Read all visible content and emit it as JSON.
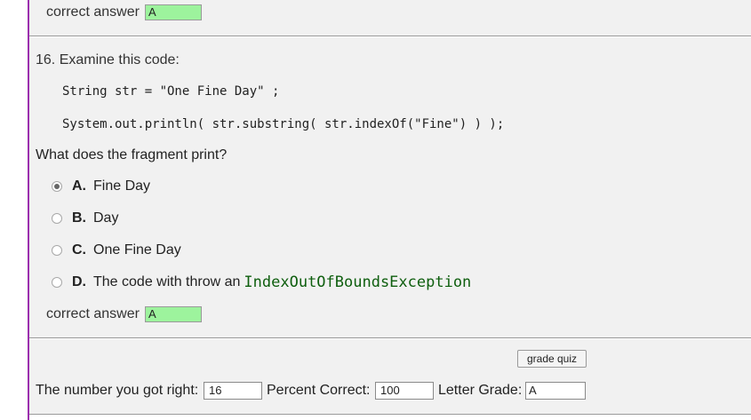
{
  "previous_question": {
    "answer_label": "correct answer",
    "answer_value": "A"
  },
  "question": {
    "title": "16. Examine this code:",
    "code_lines": [
      "String str = \"One Fine Day\" ;",
      "System.out.println( str.substring( str.indexOf(\"Fine\") ) );"
    ],
    "prompt": "What does the fragment print?",
    "options": [
      {
        "letter": "A.",
        "text": "Fine Day",
        "selected": true
      },
      {
        "letter": "B.",
        "text": "Day",
        "selected": false
      },
      {
        "letter": "C.",
        "text": "One Fine Day",
        "selected": false
      },
      {
        "letter": "D.",
        "text": "The code with throw an",
        "code": "IndexOutOfBoundsException",
        "selected": false
      }
    ],
    "answer_label": "correct answer",
    "answer_value": "A"
  },
  "grading": {
    "button_label": "grade quiz",
    "right_label": "The number you got right:",
    "right_value": "16",
    "percent_label": "Percent Correct:",
    "percent_value": "100",
    "grade_label": "Letter Grade:",
    "grade_value": "A"
  },
  "colors": {
    "left_rule": "#9b2fae",
    "correct_answer_bg": "#9df39d",
    "code_green": "#0e5e0e"
  }
}
